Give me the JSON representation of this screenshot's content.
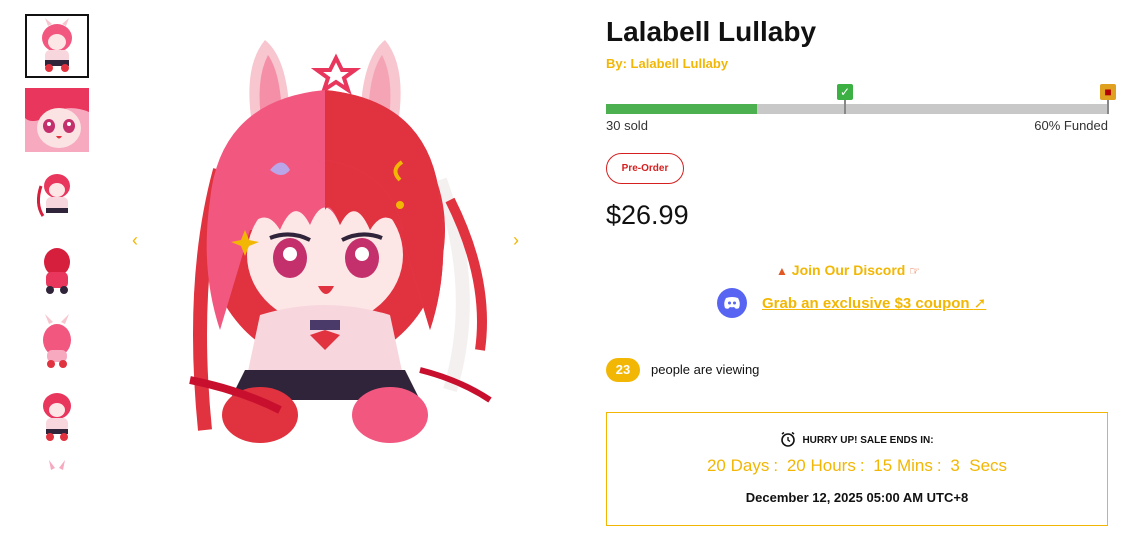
{
  "gallery": {
    "thumbnail_count": 7,
    "active_index": 0,
    "prev_icon": "chevron-left-icon",
    "next_icon": "chevron-right-icon"
  },
  "product": {
    "title": "Lalabell Lullaby",
    "byline": "By: Lalabell Lullaby",
    "badge": "Pre-Order",
    "price": "$26.99"
  },
  "funding": {
    "sold_label": "30 sold",
    "funded_label": "60% Funded",
    "progress": 0.3,
    "milestones": [
      "check-icon",
      "gift-icon"
    ]
  },
  "discord": {
    "heading": "Join Our Discord",
    "coupon_link": "Grab an exclusive $3 coupon",
    "icon": "discord-icon"
  },
  "viewers": {
    "count": "23",
    "text": "people are viewing"
  },
  "sale": {
    "heading": "HURRY UP! SALE ENDS IN:",
    "days_value": "20",
    "days_label": "Days",
    "hours_value": "20",
    "hours_label": "Hours",
    "mins_value": "15",
    "mins_label": "Mins",
    "secs_value": "3",
    "secs_label": "Secs",
    "separator": ":",
    "end_date": "December 12, 2025 05:00 AM UTC+8"
  },
  "colors": {
    "accent": "#f2b705",
    "progress_fill": "#4caf50",
    "progress_track": "#c8c8c8",
    "preorder": "#d61f1f",
    "discord": "#5865f2"
  }
}
